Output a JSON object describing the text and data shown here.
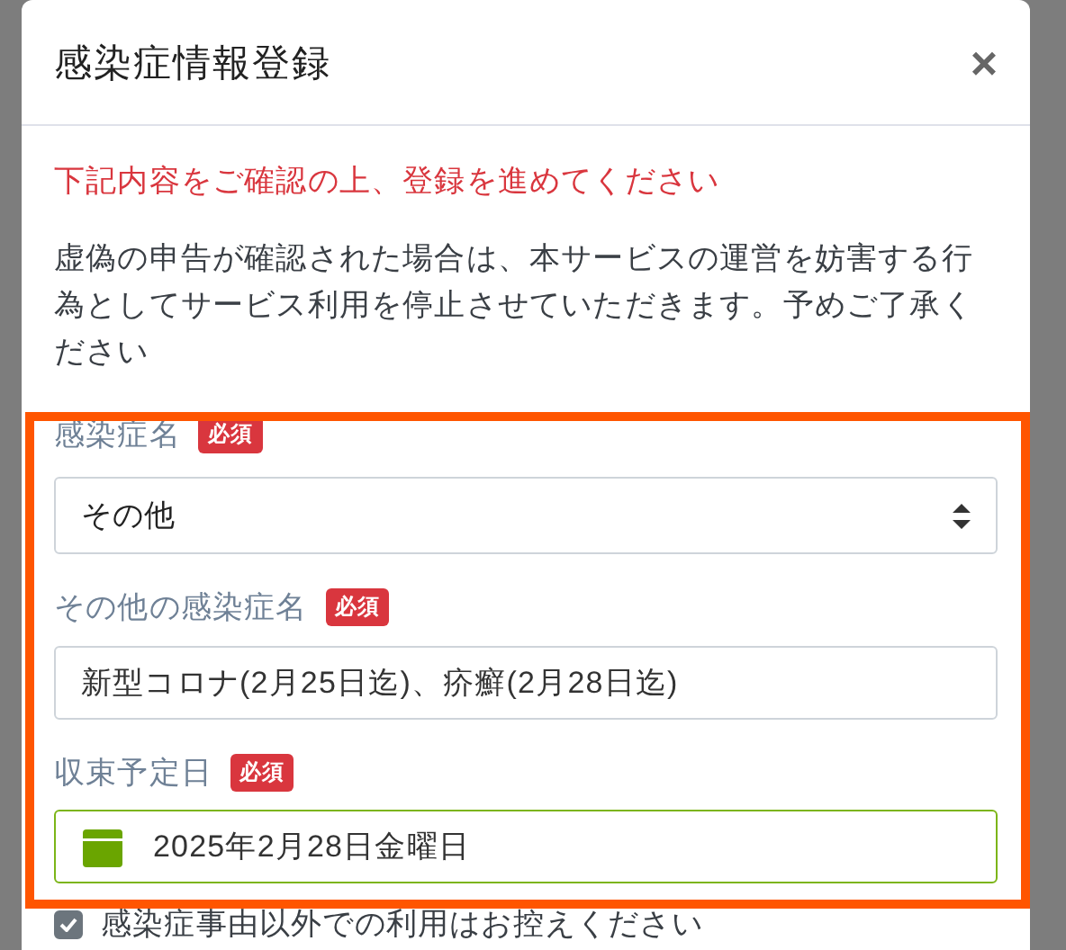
{
  "dialog": {
    "title": "感染症情報登録",
    "close": "×"
  },
  "notice": "下記内容をご確認の上、登録を進めてください",
  "description": "虚偽の申告が確認された場合は、本サービスの運営を妨害する行為としてサービス利用を停止させていただきます。予めご了承ください",
  "form": {
    "highlighted": true,
    "fields": [
      {
        "kind": "select",
        "label": "感染症名",
        "badge": "必須",
        "value": "その他"
      },
      {
        "kind": "text",
        "label": "その他の感染症名",
        "badge": "必須",
        "value": "新型コロナ(2月25日迄)、疥癬(2月28日迄)"
      },
      {
        "kind": "date",
        "label": "収束予定日",
        "badge": "必須",
        "value": "2025年2月28日金曜日"
      }
    ]
  },
  "agreement": {
    "label": "感染症事由以外での利用はお控えください",
    "checked": true
  }
}
